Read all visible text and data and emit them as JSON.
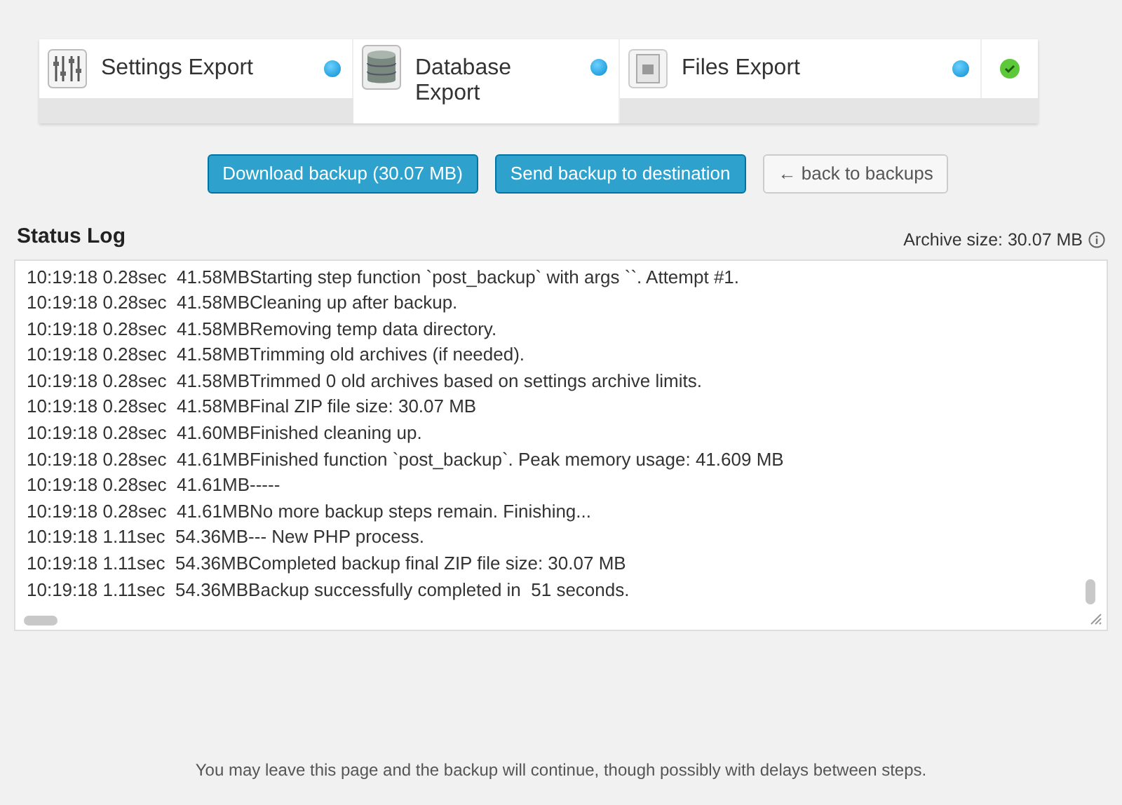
{
  "steps": [
    {
      "kind": "settings",
      "label": "Settings Export",
      "selected": false,
      "done": true
    },
    {
      "kind": "database",
      "label": "Database Export",
      "selected": true,
      "done": true
    },
    {
      "kind": "files",
      "label": "Files Export",
      "selected": false,
      "done": true
    },
    {
      "kind": "final",
      "done": true
    }
  ],
  "buttons": [
    {
      "kind": "primary",
      "label": "Download backup (30.07 MB)"
    },
    {
      "kind": "primary",
      "label": "Send backup to destination"
    },
    {
      "kind": "secondary",
      "label": "← back to backups"
    }
  ],
  "status_log": {
    "title": "Status Log",
    "archive_size": "Archive size: 30.07 MB",
    "lines": [
      "10:19:18 0.28sec  41.58MBStarting step function `post_backup` with args ``. Attempt #1.",
      "10:19:18 0.28sec  41.58MBCleaning up after backup.",
      "10:19:18 0.28sec  41.58MBRemoving temp data directory.",
      "10:19:18 0.28sec  41.58MBTrimming old archives (if needed).",
      "10:19:18 0.28sec  41.58MBTrimmed 0 old archives based on settings archive limits.",
      "10:19:18 0.28sec  41.58MBFinal ZIP file size: 30.07 MB",
      "10:19:18 0.28sec  41.60MBFinished cleaning up.",
      "10:19:18 0.28sec  41.61MBFinished function `post_backup`. Peak memory usage: 41.609 MB",
      "10:19:18 0.28sec  41.61MB-----",
      "10:19:18 0.28sec  41.61MBNo more backup steps remain. Finishing...",
      "10:19:18 1.11sec  54.36MB--- New PHP process.",
      "10:19:18 1.11sec  54.36MBCompleted backup final ZIP file size: 30.07 MB",
      "10:19:18 1.11sec  54.36MBBackup successfully completed in  51 seconds."
    ]
  },
  "footer": "You may leave this page and the backup will continue, though possibly with delays between steps."
}
